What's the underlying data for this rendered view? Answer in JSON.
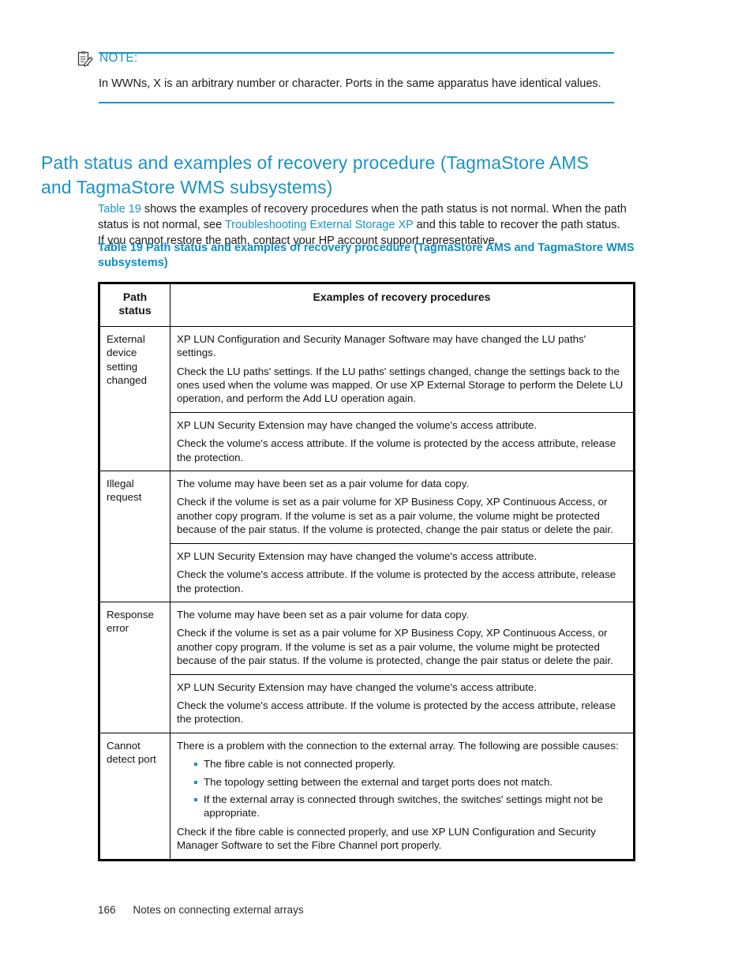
{
  "note": {
    "icon": "note-clipboard-icon",
    "label": "NOTE:",
    "body": "In WWNs, X is an arbitrary number or character. Ports in the same apparatus have identical values."
  },
  "section": {
    "heading": "Path status and examples of recovery procedure (TagmaStore AMS and TagmaStore WMS subsystems)"
  },
  "intro": {
    "link_table": "Table 19",
    "text_1": " shows the examples of recovery procedures when the path status is not normal. When the path status is not normal, see ",
    "link_troubleshooting": "Troubleshooting External Storage XP",
    "text_2": " and this table to recover the path status. If you cannot restore the path, contact your HP account support representative."
  },
  "table": {
    "caption": "Table 19 Path status and examples of recovery procedure (TagmaStore AMS and TagmaStore WMS subsystems)",
    "headers": {
      "col1": "Path status",
      "col2": "Examples of recovery procedures"
    },
    "rows": [
      {
        "status": "External device setting changed",
        "blocks": [
          {
            "paragraphs": [
              "XP LUN Configuration and Security Manager Software may have changed the LU paths' settings.",
              "Check the LU paths' settings. If the LU paths' settings changed, change the settings back to the ones used when the volume was mapped. Or use XP External Storage to perform the Delete LU operation, and perform the Add LU operation again."
            ]
          },
          {
            "paragraphs": [
              "XP LUN Security Extension may have changed the volume's access attribute.",
              "Check the volume's access attribute. If the volume is protected by the access attribute, release the protection."
            ]
          }
        ]
      },
      {
        "status": "Illegal request",
        "blocks": [
          {
            "paragraphs": [
              "The volume may have been set as a pair volume for data copy.",
              "Check if the volume is set as a pair volume for XP Business Copy, XP Continuous Access, or another copy program. If the volume is set as a pair volume, the volume might be protected because of the pair status. If the volume is protected, change the pair status or delete the pair."
            ]
          },
          {
            "paragraphs": [
              "XP LUN Security Extension may have changed the volume's access attribute.",
              "Check the volume's access attribute. If the volume is protected by the access attribute, release the protection."
            ]
          }
        ]
      },
      {
        "status": "Response error",
        "blocks": [
          {
            "paragraphs": [
              "The volume may have been set as a pair volume for data copy.",
              "Check if the volume is set as a pair volume for XP Business Copy, XP Continuous Access, or another copy program. If the volume is set as a pair volume, the volume might be protected because of the pair status. If the volume is protected, change the pair status or delete the pair."
            ]
          },
          {
            "paragraphs": [
              "XP LUN Security Extension may have changed the volume's access attribute.",
              "Check the volume's access attribute. If the volume is protected by the access attribute, release the protection."
            ]
          }
        ]
      },
      {
        "status": "Cannot detect port",
        "blocks": [
          {
            "intro": "There is a problem with the connection to the external array. The following are possible causes:",
            "bullets": [
              "The fibre cable is not connected properly.",
              "The topology setting between the external and target ports does not match.",
              "If the external array is connected through switches, the switches' settings might not be appropriate."
            ],
            "outro": "Check if the fibre cable is connected properly, and use XP LUN Configuration and Security Manager Software to set the Fibre Channel port properly."
          }
        ]
      }
    ]
  },
  "footer": {
    "page_number": "166",
    "chapter": "Notes on connecting external arrays"
  },
  "colors": {
    "accent_blue": "#1b93c4",
    "caption_blue": "#0d8ec4",
    "text_black": "#141414"
  }
}
